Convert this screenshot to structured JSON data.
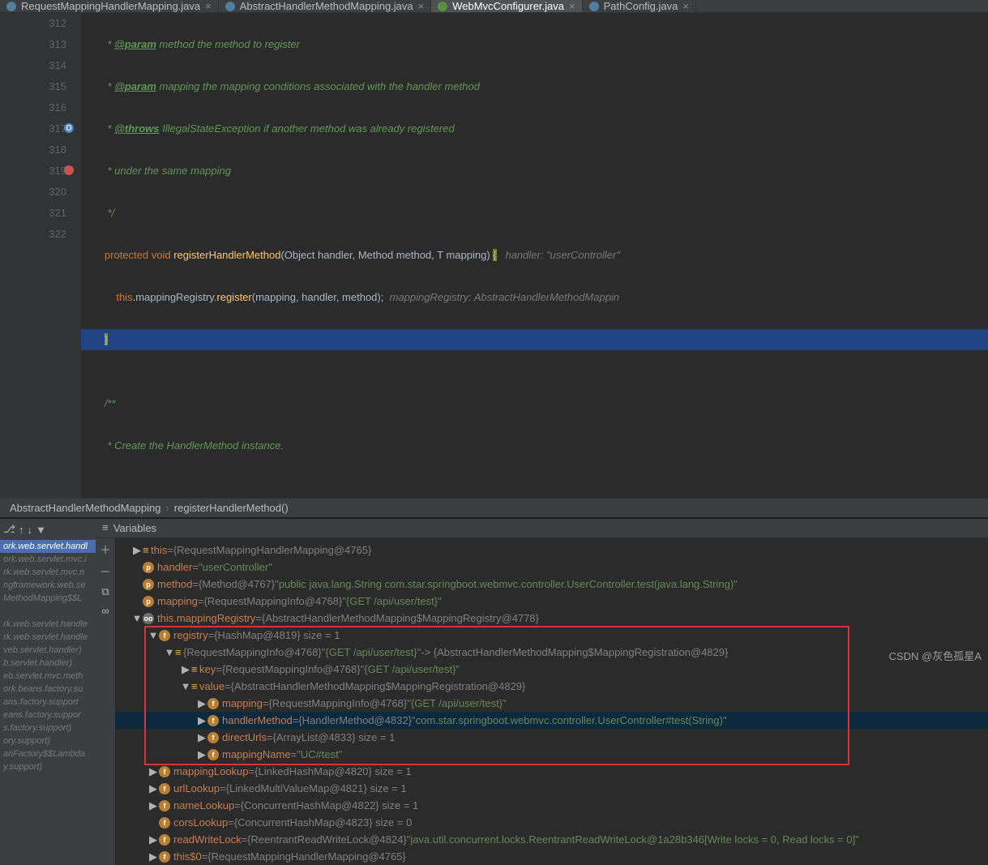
{
  "tabs": [
    {
      "label": "RequestMappingHandlerMapping.java",
      "icon": "ico-c"
    },
    {
      "label": "AbstractHandlerMethodMapping.java",
      "icon": "ico-c"
    },
    {
      "label": "WebMvcConfigurer.java",
      "active": true,
      "icon": "ico-i"
    },
    {
      "label": "PathConfig.java",
      "icon": "ico-c"
    }
  ],
  "lines": [
    "312",
    "313",
    "314",
    "315",
    "316",
    "317",
    "318",
    "319",
    "320",
    "321",
    "322"
  ],
  "code": {
    "c312_a": "         * ",
    "c312_t": "@param",
    "c312_b": " method the method to register",
    "c313_a": "         * ",
    "c313_t": "@param",
    "c313_b": " mapping the mapping conditions associated with the handler method",
    "c314_a": "         * ",
    "c314_t": "@throws",
    "c314_b": " IllegalStateException if another method was already registered",
    "c315": "         * under the same mapping",
    "c316": "         */",
    "c317_a": "        ",
    "c317_k1": "protected",
    "c317_s1": " ",
    "c317_k2": "void",
    "c317_s2": " ",
    "c317_id": "registerHandlerMethod",
    "c317_p": "(Object handler, Method method, T mapping) ",
    "c317_br": "{",
    "c317_h": "   handler: \"userController\"",
    "c318_a": "            ",
    "c318_k": "this",
    "c318_b": ".mappingRegistry.",
    "c318_id": "register",
    "c318_p": "(mapping, handler, method);  ",
    "c318_h": "mappingRegistry: AbstractHandlerMethodMappin",
    "c319_a": "        ",
    "c319_b": "}",
    "c321": "        /**",
    "c322": "         * Create the HandlerMethod instance."
  },
  "breadcrumb": {
    "a": "AbstractHandlerMethodMapping",
    "b": "registerHandlerMethod()"
  },
  "frames": [
    "ork.web.servlet.handl",
    "ork.web.servlet.mvc.i",
    "rk.web.servlet.mvc.n",
    "ngframework.web.se",
    "MethodMapping$$L",
    "",
    "rk.web.servlet.handle",
    "rk.web.servlet.handle",
    "veb.servlet.handler) ",
    "b.servlet.handler) ",
    "eb.servlet.mvc.meth",
    "ork.beans.factory.su",
    "ans.factory.support",
    "eans.factory.suppor",
    "s.factory.support) ",
    "ory.support) ",
    "anFactory$$Lambda",
    "y.support) "
  ],
  "varsTitle": "Variables",
  "tree": [
    {
      "d": 0,
      "arr": "▶",
      "badge": "bar",
      "nm": "this",
      "eq": " = ",
      "val": "{RequestMappingHandlerMapping@4765}"
    },
    {
      "d": 0,
      "arr": " ",
      "badge": "p",
      "nm": "handler",
      "eq": " = ",
      "str": "\"userController\""
    },
    {
      "d": 0,
      "arr": " ",
      "badge": "p",
      "nm": "method",
      "eq": " = ",
      "val": "{Method@4767} ",
      "str": "\"public java.lang.String com.star.springboot.webmvc.controller.UserController.test(java.lang.String)\""
    },
    {
      "d": 0,
      "arr": " ",
      "badge": "p",
      "nm": "mapping",
      "eq": " = ",
      "val": "{RequestMappingInfo@4768} ",
      "str": "\"{GET /api/user/test}\""
    },
    {
      "d": 0,
      "arr": "▼",
      "badge": "oo",
      "nm": "this.mappingRegistry",
      "eq": " = ",
      "val": "{AbstractHandlerMethodMapping$MappingRegistry@4778}"
    },
    {
      "d": 1,
      "arr": "▼",
      "badge": "f",
      "nm": "registry",
      "eq": " = ",
      "val": "{HashMap@4819}  size = 1"
    },
    {
      "d": 2,
      "arr": "▼",
      "badge": "bar",
      "nm": " ",
      "val": "{RequestMappingInfo@4768} ",
      "str": "\"{GET /api/user/test}\"",
      "tail": " -> {AbstractHandlerMethodMapping$MappingRegistration@4829}"
    },
    {
      "d": 3,
      "arr": "▶",
      "badge": "bar",
      "nm": "key",
      "eq": " = ",
      "val": "{RequestMappingInfo@4768} ",
      "str": "\"{GET /api/user/test}\""
    },
    {
      "d": 3,
      "arr": "▼",
      "badge": "bar",
      "nm": "value",
      "eq": " = ",
      "val": "{AbstractHandlerMethodMapping$MappingRegistration@4829}"
    },
    {
      "d": 4,
      "arr": "▶",
      "badge": "f",
      "nm": "mapping",
      "eq": " = ",
      "val": "{RequestMappingInfo@4768} ",
      "str": "\"{GET /api/user/test}\""
    },
    {
      "d": 4,
      "arr": "▶",
      "badge": "f",
      "nm": "handlerMethod",
      "eq": " = ",
      "val": "{HandlerMethod@4832} ",
      "str": "\"com.star.springboot.webmvc.controller.UserController#test(String)\"",
      "sel": true
    },
    {
      "d": 4,
      "arr": "▶",
      "badge": "f",
      "nm": "directUrls",
      "eq": " = ",
      "val": "{ArrayList@4833}  size = 1"
    },
    {
      "d": 4,
      "arr": "▶",
      "badge": "f",
      "nm": "mappingName",
      "eq": " = ",
      "str": "\"UC#test\""
    },
    {
      "d": 1,
      "arr": "▶",
      "badge": "f",
      "nm": "mappingLookup",
      "eq": " = ",
      "val": "{LinkedHashMap@4820}  size = 1"
    },
    {
      "d": 1,
      "arr": "▶",
      "badge": "f",
      "nm": "urlLookup",
      "eq": " = ",
      "val": "{LinkedMultiValueMap@4821}  size = 1"
    },
    {
      "d": 1,
      "arr": "▶",
      "badge": "f",
      "nm": "nameLookup",
      "eq": " = ",
      "val": "{ConcurrentHashMap@4822}  size = 1"
    },
    {
      "d": 1,
      "arr": " ",
      "badge": "f",
      "nm": "corsLookup",
      "eq": " = ",
      "val": "{ConcurrentHashMap@4823}  size = 0"
    },
    {
      "d": 1,
      "arr": "▶",
      "badge": "f",
      "nm": "readWriteLock",
      "eq": " = ",
      "val": "{ReentrantReadWriteLock@4824} ",
      "str": "\"java.util.concurrent.locks.ReentrantReadWriteLock@1a28b346[Write locks = 0, Read locks = 0]\""
    },
    {
      "d": 1,
      "arr": "▶",
      "badge": "f",
      "nm": "this$0",
      "eq": " = ",
      "val": "{RequestMappingHandlerMapping@4765}"
    }
  ],
  "watermark": "CSDN @灰色孤星A"
}
